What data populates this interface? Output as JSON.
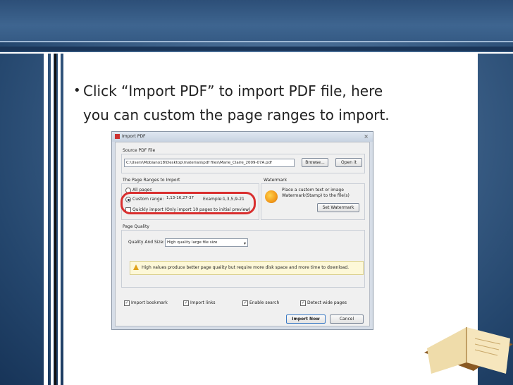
{
  "slide": {
    "bullet_lines": [
      "Click “Import PDF” to import PDF file, here",
      "you can custom the page ranges to import."
    ],
    "bullet_mark": "•",
    "colors": {
      "background": "#2c5078",
      "panel": "#ffffff",
      "highlight_circle": "#d92f2f"
    }
  },
  "dialog": {
    "title": "Import PDF",
    "close_glyph": "×",
    "source_group_label": "Source PDF File",
    "file_path": "C:\\Users\\Mobiano18\\Desktop\\materials\\pdf files\\Marie_Claire_2009-07A.pdf",
    "browse_label": "Browse...",
    "open_it_label": "Open it",
    "page_ranges_group_label": "The Page Ranges to Import",
    "all_pages_label": "All pages",
    "custom_range_label": "Custom range:",
    "custom_range_value": "1,13-16,27-37",
    "custom_range_example": "Example:1,3,5,9-21",
    "quick_import_label": "Quickly import (Only import 10 pages to initial preview)",
    "watermark_group_label": "Watermark",
    "watermark_desc_line1": "Place a custom text or image",
    "watermark_desc_line2": "Watermark(Stamp) to the file(s)",
    "set_watermark_label": "Set Watermark",
    "page_quality_group_label": "Page Quality",
    "quality_size_label": "Quality And Size:",
    "quality_value": "High quality large file size",
    "warning_text": "High values produce better page quality but require more disk space and more time to download.",
    "options": [
      {
        "label": "Import bookmark",
        "checked": true
      },
      {
        "label": "Import links",
        "checked": true
      },
      {
        "label": "Enable search",
        "checked": true
      },
      {
        "label": "Detect wide pages",
        "checked": true
      }
    ],
    "import_now_label": "Import Now",
    "cancel_label": "Cancel",
    "check_glyph": "✓",
    "dropdown_glyph": "▾"
  }
}
